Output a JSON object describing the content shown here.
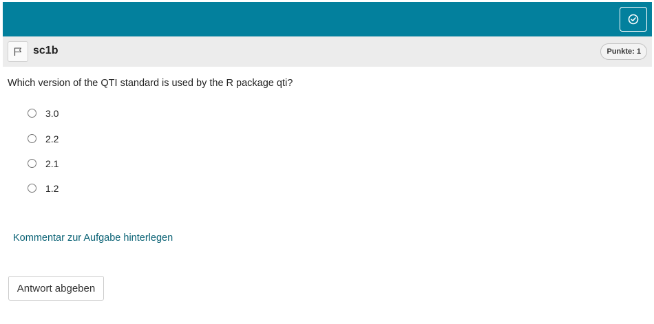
{
  "topbar": {
    "submit_all_icon": "check-circle-icon",
    "background_color": "#03809d"
  },
  "item": {
    "flag_icon": "flag-icon",
    "title": "sc1b",
    "points_badge": "Punkte: 1"
  },
  "question": {
    "text": "Which version of the QTI standard is used by the R package qti?",
    "choices": [
      {
        "label": "3.0",
        "selected": false
      },
      {
        "label": "2.2",
        "selected": false
      },
      {
        "label": "2.1",
        "selected": false
      },
      {
        "label": "1.2",
        "selected": false
      }
    ]
  },
  "comment_link": "Kommentar zur Aufgabe hinterlegen",
  "answer_button": "Antwort abgeben",
  "colors": {
    "accent": "#03809d",
    "link": "#0a6275"
  }
}
